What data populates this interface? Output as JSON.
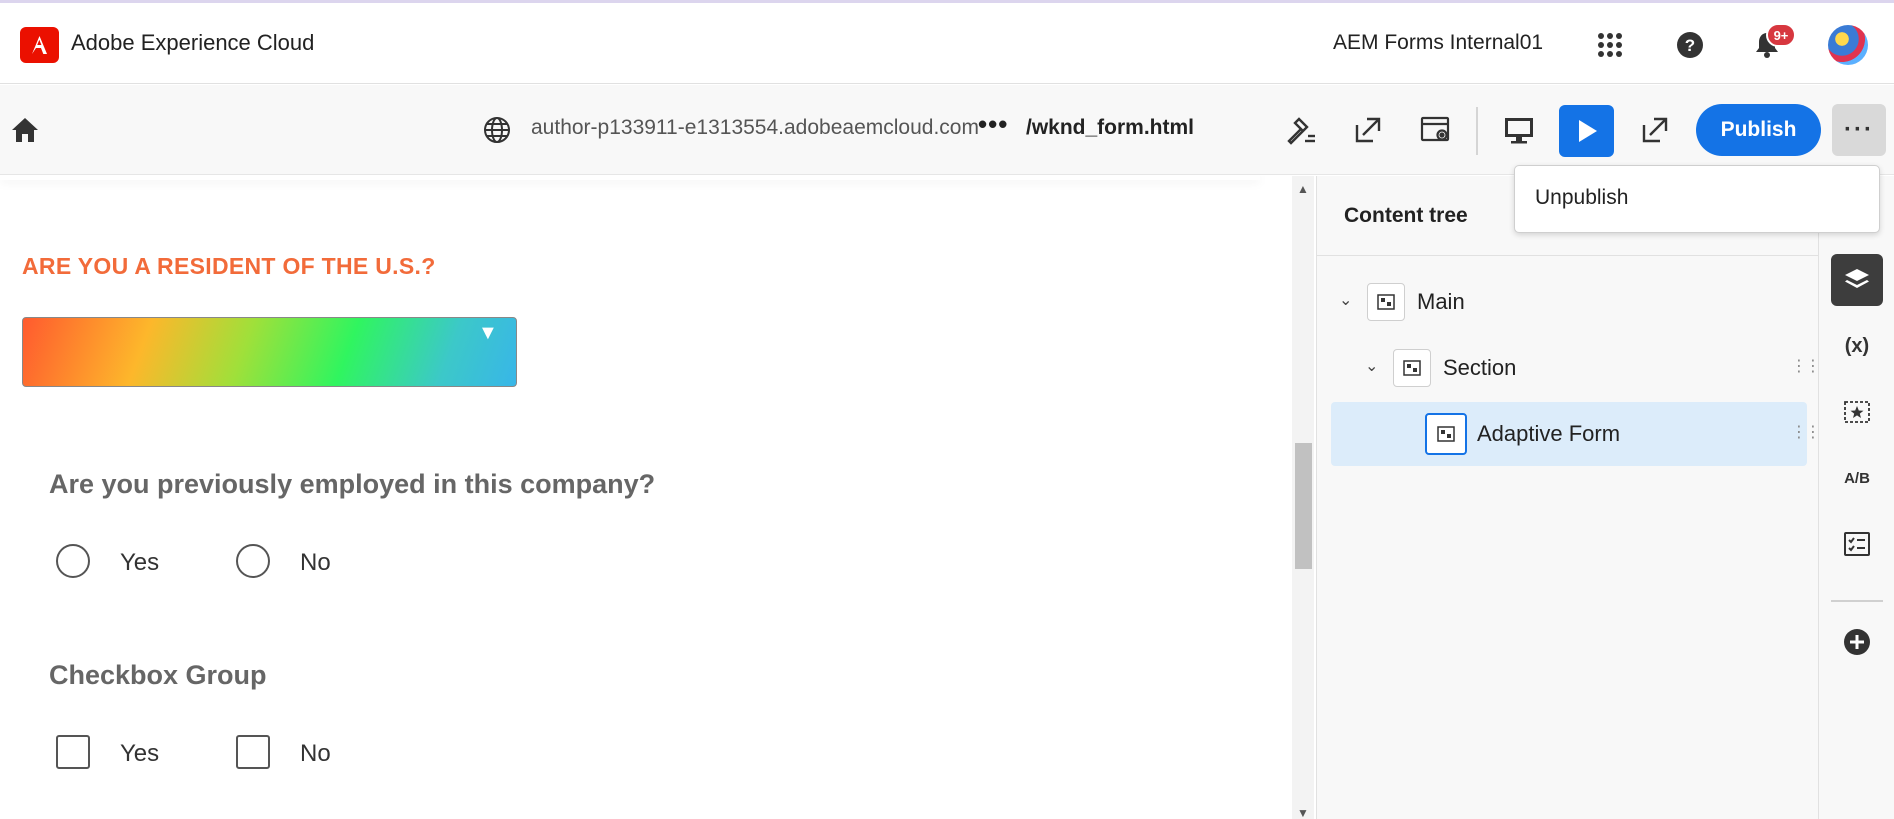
{
  "app": {
    "brand": "Adobe Experience Cloud",
    "org_name": "AEM Forms Internal01",
    "notification_count": "9+",
    "icons": [
      "adobe-logo",
      "apps-grid-icon",
      "help-icon",
      "bell-icon",
      "avatar"
    ]
  },
  "toolbar": {
    "url": "author-p133911-e1313554.adobeaemcloud.com",
    "more_label": "•••",
    "path": "/wknd_form.html",
    "publish_label": "Publish",
    "more_actions_label": "···",
    "icons": [
      "home-icon",
      "globe-icon",
      "hammer-icon",
      "open-external-icon",
      "page-settings-icon",
      "desktop-icon",
      "play-icon",
      "open-in-new-icon"
    ],
    "colors": {
      "accent": "#1473e6"
    }
  },
  "popover": {
    "items": [
      "Unpublish"
    ]
  },
  "form": {
    "resident_question": "ARE YOU A RESIDENT OF THE U.S.?",
    "resident_color": "#f26b3a",
    "employed_question": "Are you previously employed in this company?",
    "employed_options": [
      "Yes",
      "No"
    ],
    "checkbox_group_title": "Checkbox Group",
    "checkbox_options": [
      "Yes",
      "No"
    ]
  },
  "content_tree": {
    "title": "Content tree",
    "nodes": [
      {
        "label": "Main",
        "expanded": true,
        "selected": false
      },
      {
        "label": "Section",
        "expanded": true,
        "selected": false
      },
      {
        "label": "Adaptive Form",
        "expanded": false,
        "selected": true
      }
    ]
  },
  "rail": {
    "variables_label": "(x)",
    "ab_label": "A/B",
    "icons": [
      "layers-icon",
      "variables-icon",
      "star-frame-icon",
      "ab-test-icon",
      "checklist-icon",
      "add-icon"
    ]
  }
}
